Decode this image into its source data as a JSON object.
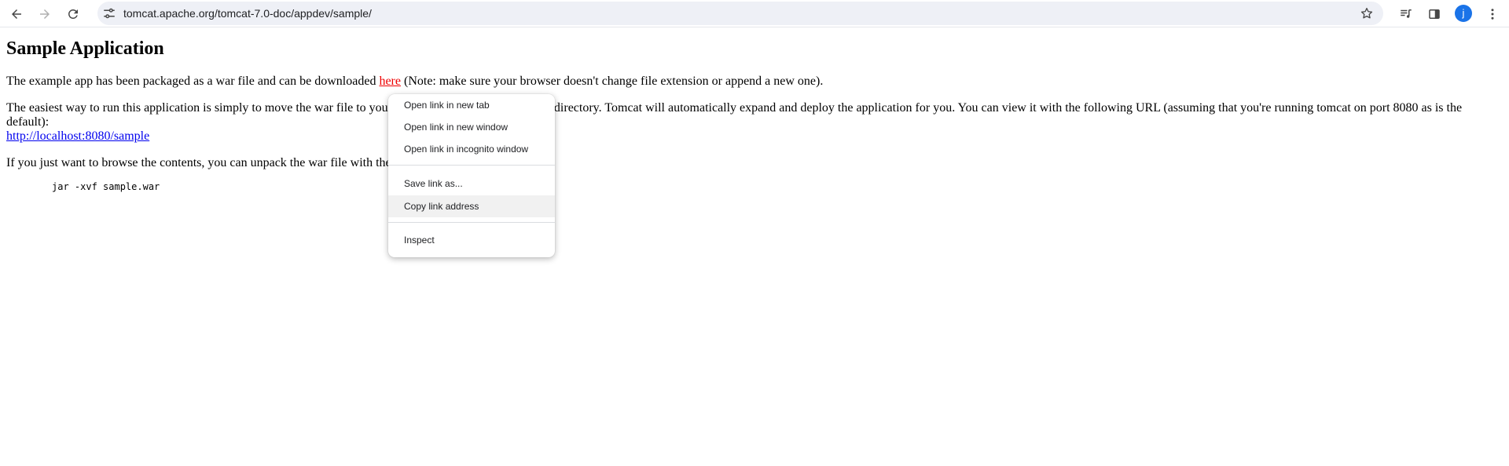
{
  "browser": {
    "url": "tomcat.apache.org/tomcat-7.0-doc/appdev/sample/",
    "profile_initial": "j",
    "icons": [
      "back-icon",
      "forward-icon",
      "reload-icon",
      "site-settings-icon",
      "bookmark-star-icon",
      "media-controls-icon",
      "side-panel-icon",
      "profile-avatar",
      "more-menu-icon"
    ]
  },
  "page": {
    "title": "Sample Application",
    "p1_before": "The example app has been packaged as a war file and can be downloaded ",
    "p1_link": "here",
    "p1_after": " (Note: make sure your browser doesn't change file extension or append a new one).",
    "p2_text_a": "The easiest way to run this application is simply to move the war file to you",
    "p2_text_b": "s directory. Tomcat will automatically expand and deploy the application for you. You can view it with the following URL (assuming that you're running tomcat on port 8080 as is the default):",
    "p2_link": "http://localhost:8080/sample",
    "p3_text": "If you just want to browse the contents, you can unpack the war file with the",
    "code": "jar -xvf sample.war"
  },
  "context_menu": {
    "items": [
      {
        "label": "Open link in new tab"
      },
      {
        "label": "Open link in new window"
      },
      {
        "label": "Open link in incognito window"
      },
      {
        "label": "Save link as..."
      },
      {
        "label": "Copy link address",
        "hovered": true
      },
      {
        "label": "Inspect"
      }
    ]
  },
  "colors": {
    "visited_active_link": "#ee0000",
    "link": "#0000ee",
    "profile_avatar": "#1a73e8",
    "omnibox_bg": "#eef0f6",
    "menu_hover": "#f1f1f1"
  }
}
